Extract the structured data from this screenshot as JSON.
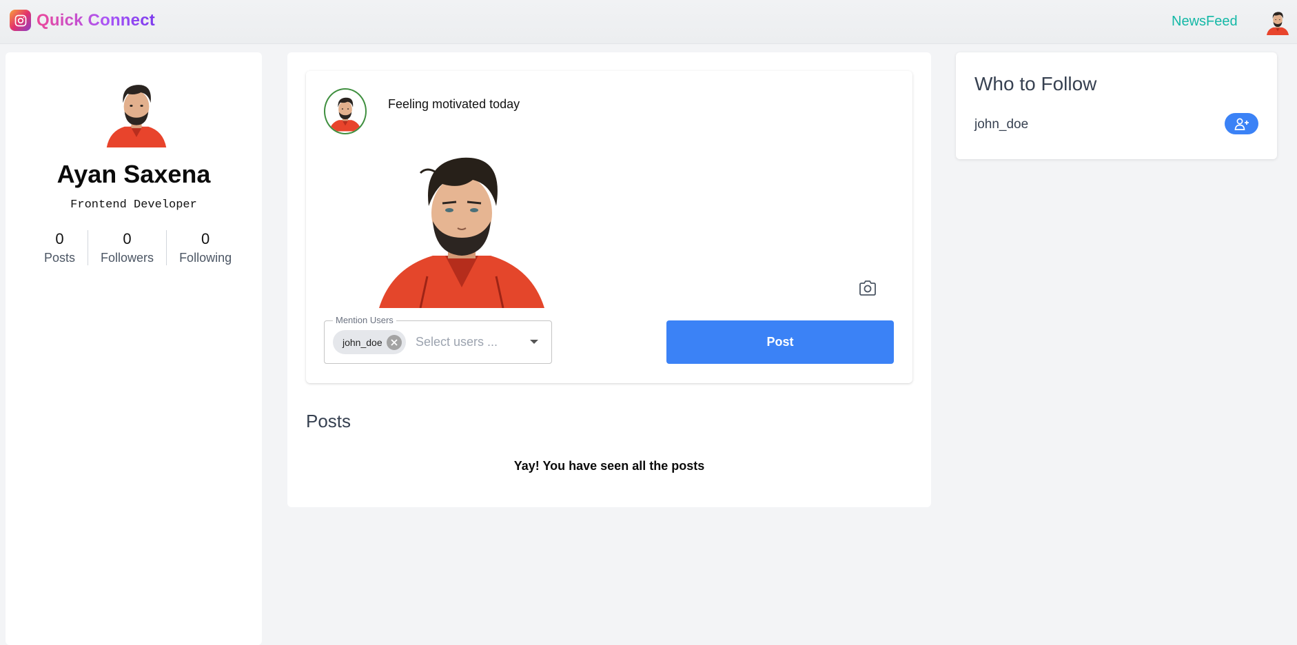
{
  "header": {
    "brand": "Quick Connect",
    "nav_link": "NewsFeed",
    "brand_gradient": [
      "#ec4899",
      "#7c3aed"
    ],
    "nav_color": "#14b8a6"
  },
  "profile": {
    "name": "Ayan Saxena",
    "role": "Frontend Developer",
    "stats": [
      {
        "value": "0",
        "label": "Posts"
      },
      {
        "value": "0",
        "label": "Followers"
      },
      {
        "value": "0",
        "label": "Following"
      }
    ]
  },
  "composer": {
    "text": "Feeling motivated today",
    "mention": {
      "legend": "Mention Users",
      "chips": [
        "john_doe"
      ],
      "placeholder": "Select users ..."
    },
    "post_label": "Post",
    "accent": "#3b82f6"
  },
  "feed": {
    "posts_title": "Posts",
    "end_message": "Yay! You have seen all the posts"
  },
  "who_to_follow": {
    "title": "Who to Follow",
    "users": [
      {
        "username": "john_doe"
      }
    ]
  },
  "icons": {
    "brand": "instagram-icon",
    "camera": "camera-icon",
    "chip_remove": "cancel-circle-icon",
    "dropdown": "dropdown-arrow-icon",
    "follow": "user-plus-icon"
  }
}
